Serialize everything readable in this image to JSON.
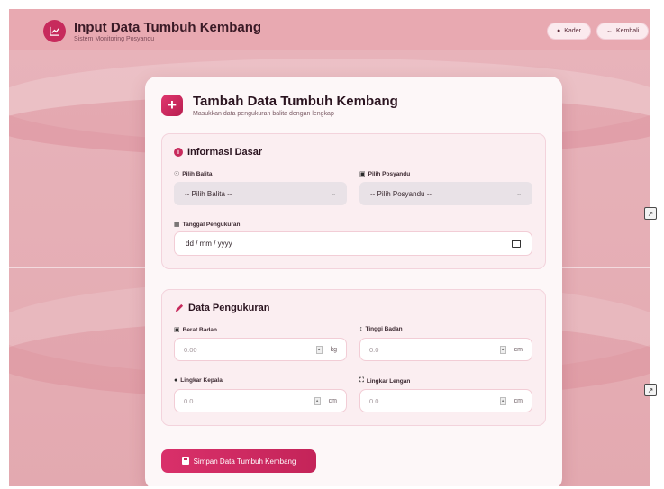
{
  "header": {
    "title": "Input Data Tumbuh Kembang",
    "subtitle": "Sistem Monitoring Posyandu",
    "kader_label": "Kader",
    "kembali_label": "Kembali"
  },
  "card": {
    "title": "Tambah Data Tumbuh Kembang",
    "subtitle": "Masukkan data pengukuran balita dengan lengkap"
  },
  "info": {
    "title": "Informasi Dasar",
    "balita_label": "Pilih Balita",
    "balita_value": "-- Pilih Balita --",
    "posyandu_label": "Pilih Posyandu",
    "posyandu_value": "-- Pilih Posyandu --",
    "tanggal_label": "Tanggal Pengukuran",
    "tanggal_placeholder": "dd / mm / yyyy"
  },
  "pengukuran": {
    "title": "Data Pengukuran",
    "berat_label": "Berat Badan",
    "berat_placeholder": "0.00",
    "berat_unit": "kg",
    "tinggi_label": "Tinggi Badan",
    "tinggi_placeholder": "0.0",
    "tinggi_unit": "cm",
    "kepala_label": "Lingkar Kepala",
    "kepala_placeholder": "0.0",
    "kepala_unit": "cm",
    "lengan_label": "Lingkar Lengan",
    "lengan_placeholder": "0.0",
    "lengan_unit": "cm"
  },
  "save_label": "Simpan Data Tumbuh Kembang",
  "icons": {
    "logo": "chart-line-icon",
    "kader": "user-circle-icon",
    "kembali": "arrow-left-icon",
    "plus": "plus-icon",
    "info": "info-circle-icon",
    "balita": "child-icon",
    "posyandu": "car-icon",
    "tanggal": "calendar-icon",
    "pengukuran": "pencil-icon",
    "berat": "weight-icon",
    "tinggi": "arrows-vertical-icon",
    "kepala": "circle-icon",
    "lengan": "expand-icon",
    "save": "floppy-disk-icon"
  },
  "colors": {
    "accent": "#c72a5c",
    "background": "#e8b4bb",
    "card": "#fdf7f8",
    "panel": "#fbeef1"
  }
}
